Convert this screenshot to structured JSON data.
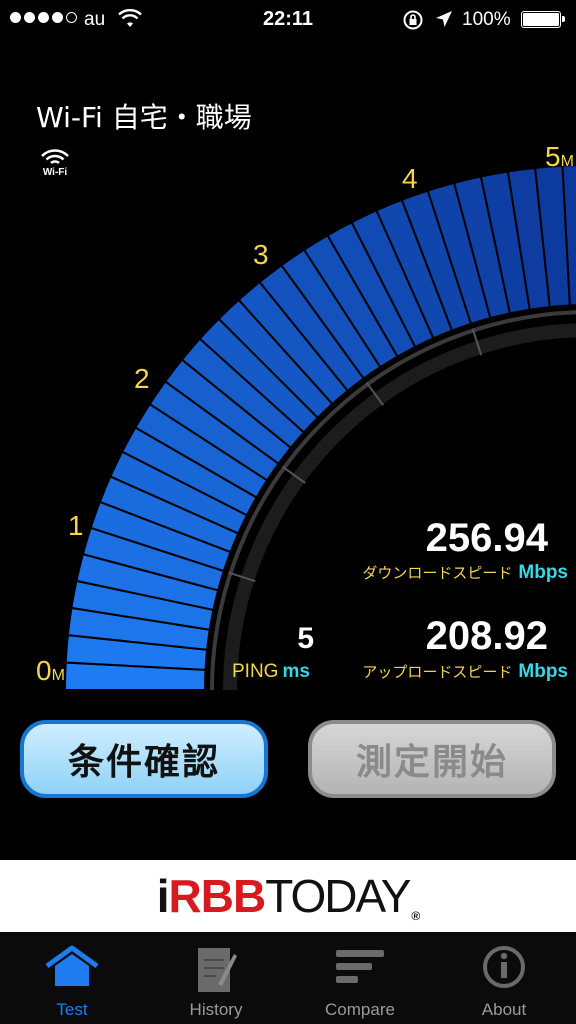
{
  "status_bar": {
    "carrier": "au",
    "time": "22:11",
    "battery": "100%",
    "signal_bars": 4
  },
  "network": {
    "title": "Wi-Fi 自宅・職場",
    "badge_label": "Wi-Fi"
  },
  "gauge": {
    "scale_labels": [
      "0M",
      "1",
      "2",
      "3",
      "4",
      "5M"
    ],
    "fill_fraction": 1.0,
    "colors": {
      "scale_label": "#f3d64b",
      "segment": "#1565e0",
      "segment_dark": "#0a3590"
    }
  },
  "results": {
    "download": {
      "value": "256.94",
      "label": "ダウンロードスピード",
      "unit": "Mbps"
    },
    "upload": {
      "value": "208.92",
      "label": "アップロードスピード",
      "unit": "Mbps"
    },
    "ping": {
      "value": "5",
      "label": "PING",
      "unit": "ms"
    }
  },
  "buttons": {
    "conditions": "条件確認",
    "start": "測定開始"
  },
  "ad": {
    "logo_part1": "i",
    "logo_part2": "RBB",
    "logo_part3": "TODAY",
    "logo_reg": "®"
  },
  "tabs": [
    {
      "label": "Test",
      "icon": "house-icon",
      "active": true
    },
    {
      "label": "History",
      "icon": "notepad-icon",
      "active": false
    },
    {
      "label": "Compare",
      "icon": "bars-icon",
      "active": false
    },
    {
      "label": "About",
      "icon": "info-icon",
      "active": false
    }
  ],
  "colors": {
    "accent": "#1e7cf0",
    "yellow_label": "#f3d64b",
    "cyan_unit": "#38d6e6"
  }
}
